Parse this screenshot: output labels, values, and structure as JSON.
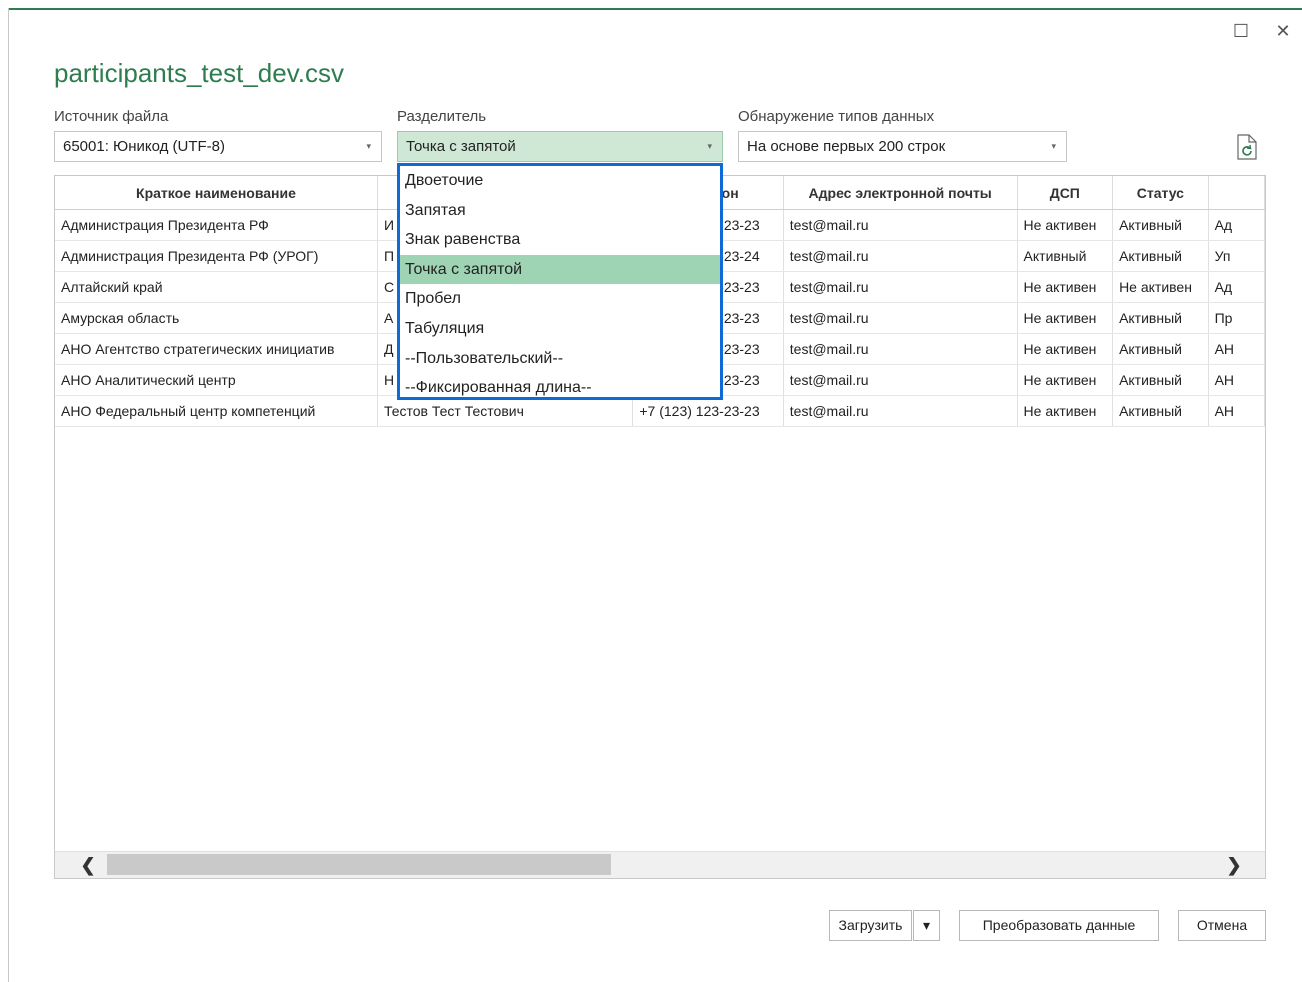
{
  "window": {
    "title": "participants_test_dev.csv",
    "maximize_glyph": "☐",
    "close_glyph": "✕"
  },
  "controls": {
    "source": {
      "label": "Источник файла",
      "value": "65001: Юникод (UTF-8)"
    },
    "delimiter": {
      "label": "Разделитель",
      "value": "Точка с запятой"
    },
    "detection": {
      "label": "Обнаружение типов данных",
      "value": "На основе первых 200 строк"
    }
  },
  "dropdown": {
    "options": [
      "Двоеточие",
      "Запятая",
      "Знак равенства",
      "Точка с запятой",
      "Пробел",
      "Табуляция",
      "--Пользовательский--",
      "--Фиксированная длина--"
    ],
    "selected_index": 3
  },
  "table": {
    "columns": [
      "Краткое наименование",
      "",
      "Телефон",
      "Адрес электронной почты",
      "ДСП",
      "Статус",
      ""
    ],
    "rows": [
      [
        "Администрация Президента РФ",
        "И",
        "+7 (123) 123-23-23",
        "test@mail.ru",
        "Не активен",
        "Активный",
        "Ад"
      ],
      [
        "Администрация Президента РФ (УРОГ)",
        "П",
        "+7 (123) 123-23-24",
        "test@mail.ru",
        "Активный",
        "Активный",
        "Уп"
      ],
      [
        "Алтайский край",
        "С",
        "+7 (123) 123-23-23",
        "test@mail.ru",
        "Не активен",
        "Не активен",
        "Ад"
      ],
      [
        "Амурская область",
        "А",
        "+7 (123) 123-23-23",
        "test@mail.ru",
        "Не активен",
        "Активный",
        "Пр"
      ],
      [
        "АНО Агентство стратегических инициатив",
        "Д",
        "+7 (123) 123-23-23",
        "test@mail.ru",
        "Не активен",
        "Активный",
        "АН"
      ],
      [
        "АНО Аналитический центр",
        "Н",
        "+7 (123) 123-23-23",
        "test@mail.ru",
        "Не активен",
        "Активный",
        "АН"
      ],
      [
        "АНО Федеральный центр компетенций",
        "Тестов Тест Тестович",
        "+7 (123) 123-23-23",
        "test@mail.ru",
        "Не активен",
        "Активный",
        "АН"
      ]
    ]
  },
  "scrollbar": {
    "left_glyph": "❮",
    "right_glyph": "❯",
    "position": 0.0
  },
  "buttons": {
    "load": "Загрузить",
    "load_dropdown": "▾",
    "transform": "Преобразовать данные",
    "cancel": "Отмена"
  },
  "caret_glyph": "▾",
  "colors": {
    "accent_green": "#2e7d4f",
    "selection_green": "#9ed4b4",
    "focus_blue": "#0f6ad8"
  }
}
